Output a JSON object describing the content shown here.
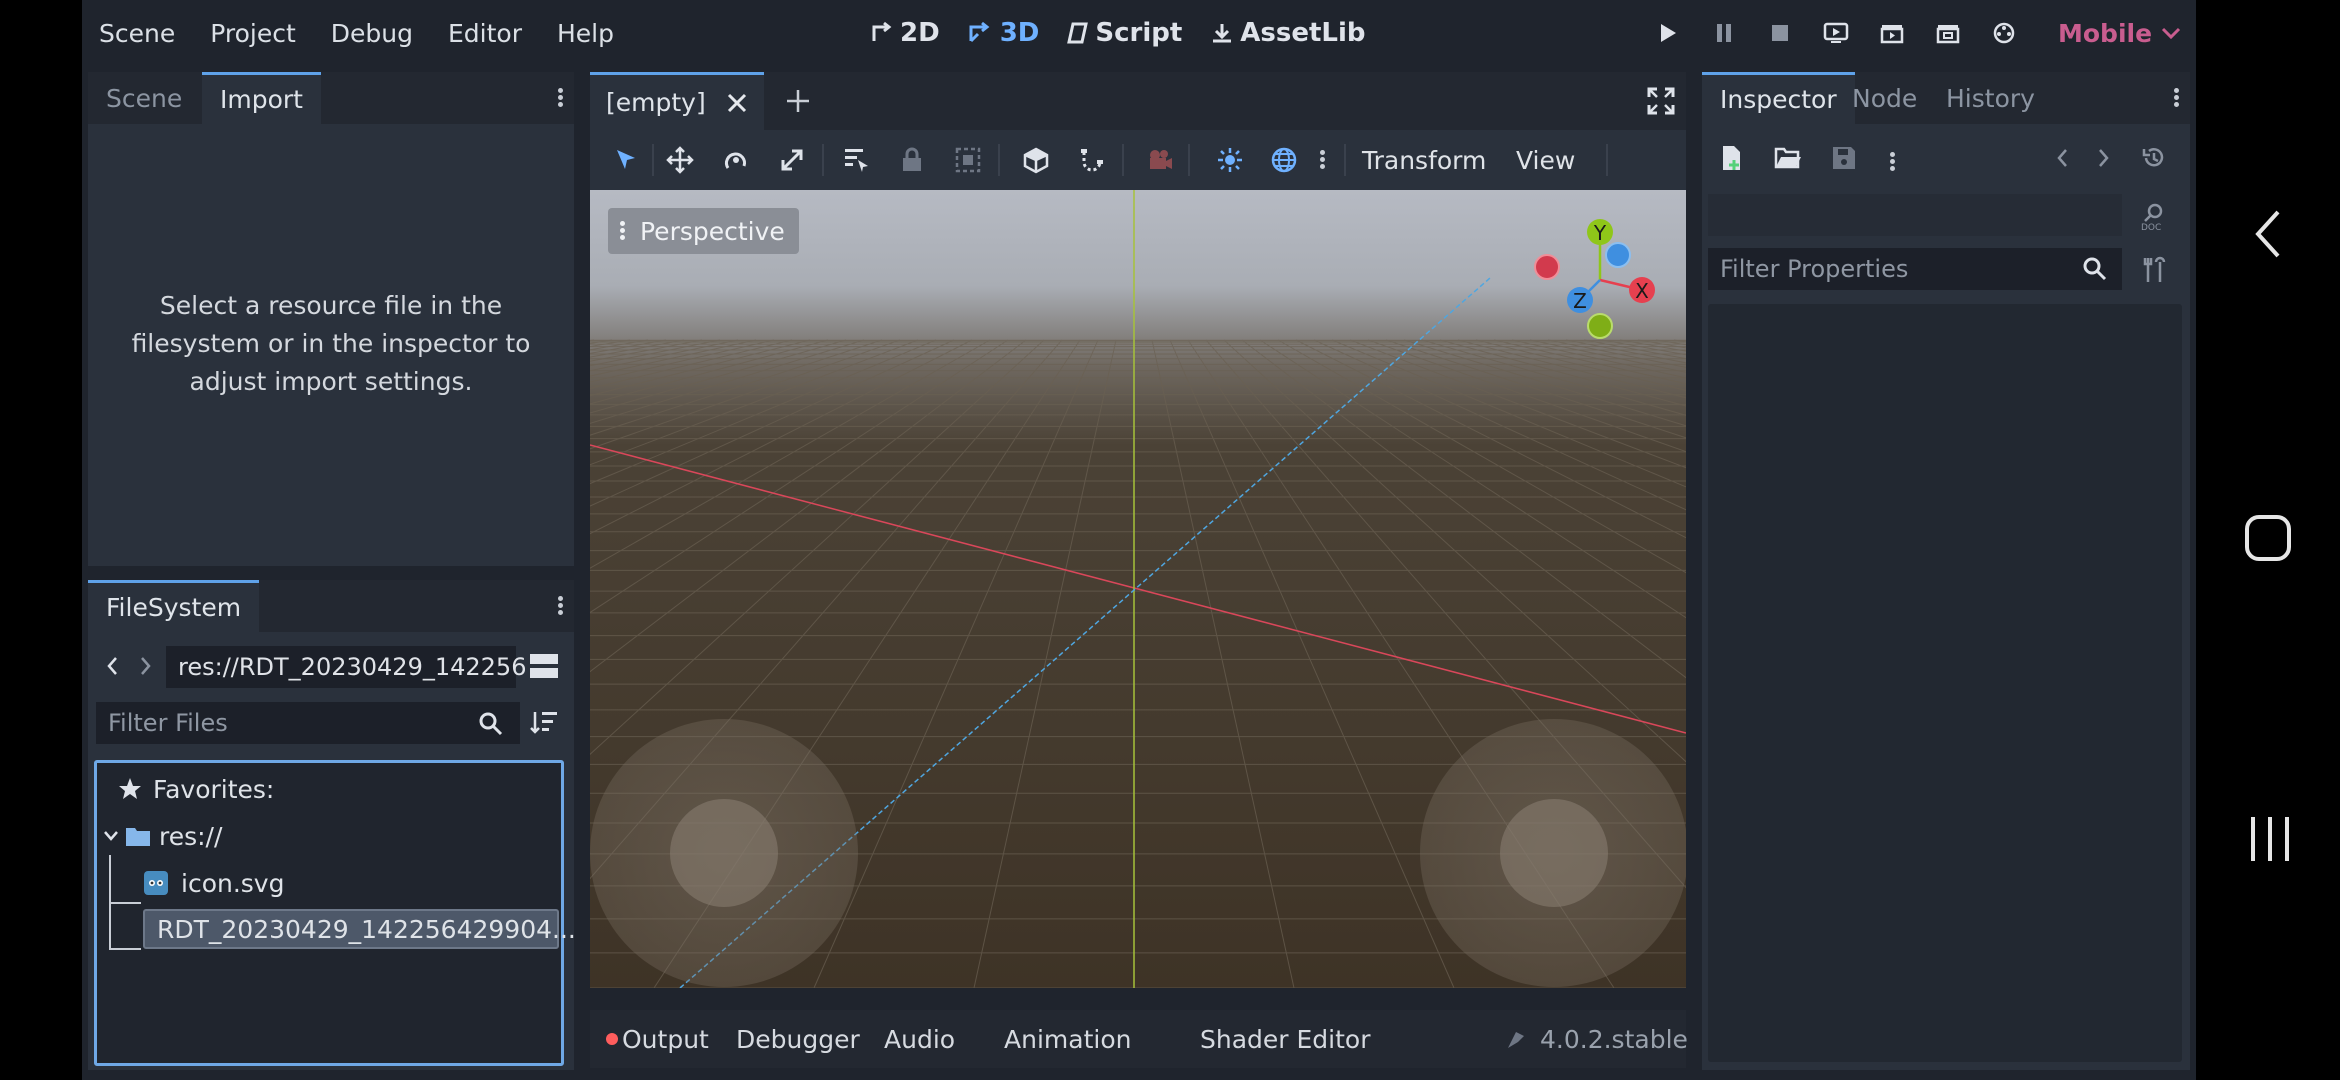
{
  "menu": [
    "Scene",
    "Project",
    "Debug",
    "Editor",
    "Help"
  ],
  "modes": [
    {
      "label": "2D",
      "icon": "2d-icon",
      "active": false
    },
    {
      "label": "3D",
      "icon": "3d-icon",
      "active": true
    },
    {
      "label": "Script",
      "icon": "script-icon",
      "active": false
    },
    {
      "label": "AssetLib",
      "icon": "assetlib-icon",
      "active": false
    }
  ],
  "renderer": "Mobile",
  "scene_dock": {
    "tabs": [
      "Scene",
      "Import"
    ],
    "active_tab": "Import",
    "import_message": "Select a resource file in the filesystem or in the inspector to adjust import settings."
  },
  "filesystem": {
    "tab": "FileSystem",
    "path": "res://RDT_20230429_142256",
    "filter_placeholder": "Filter Files",
    "favorites_label": "Favorites:",
    "root": "res://",
    "files": [
      {
        "name": "icon.svg",
        "icon": "godot-icon",
        "selected": false
      },
      {
        "name": "RDT_20230429_142256429904...",
        "icon": "error-x-icon",
        "selected": true
      }
    ]
  },
  "editor": {
    "scene_tab": "[empty]",
    "toolbar_menus": [
      "Transform",
      "View"
    ],
    "perspective_label": "Perspective",
    "gizmo": {
      "x": "X",
      "y": "Y",
      "z": "Z"
    }
  },
  "bottom_panel": {
    "tabs": [
      "Output",
      "Debugger",
      "Audio",
      "Animation",
      "Shader Editor"
    ],
    "version": "4.0.2.stable"
  },
  "inspector": {
    "tabs": [
      "Inspector",
      "Node",
      "History"
    ],
    "active_tab": "Inspector",
    "filter_placeholder": "Filter Properties"
  },
  "colors": {
    "accent": "#6fb1ff",
    "renderer_pink": "#c95d8f",
    "axis_x": "#e6404f",
    "axis_y": "#8fc619",
    "axis_z": "#3f8fe0"
  }
}
